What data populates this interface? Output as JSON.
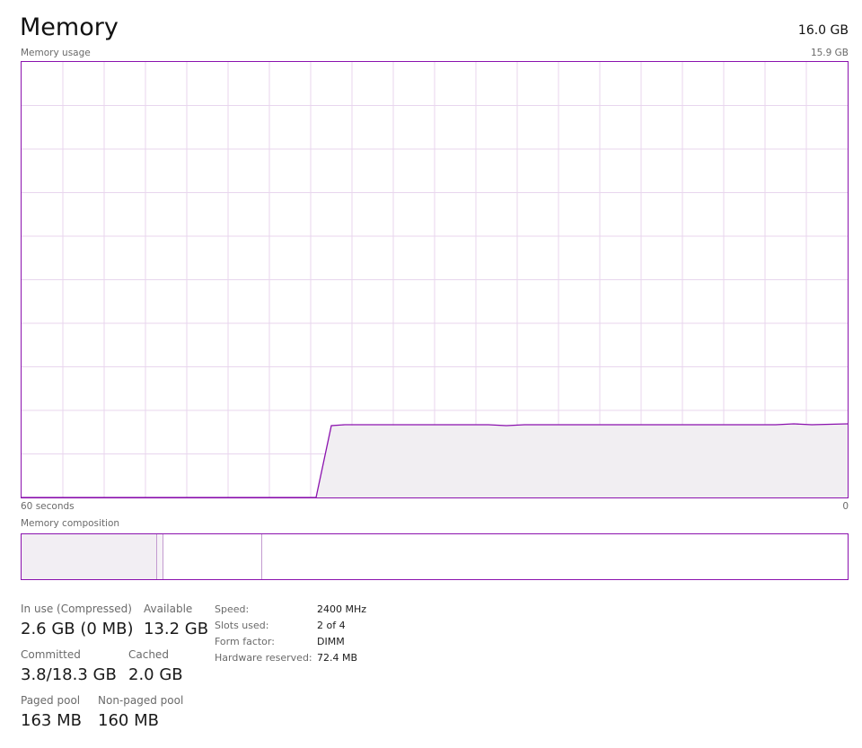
{
  "header": {
    "title": "Memory",
    "total": "16.0 GB"
  },
  "usage_graph": {
    "label": "Memory usage",
    "max_label": "15.9 GB",
    "left_axis_label": "60 seconds",
    "right_axis_label": "0"
  },
  "composition": {
    "label": "Memory composition"
  },
  "stats": {
    "in_use_label": "In use (Compressed)",
    "in_use_value": "2.6 GB (0 MB)",
    "available_label": "Available",
    "available_value": "13.2 GB",
    "committed_label": "Committed",
    "committed_value": "3.8/18.3 GB",
    "cached_label": "Cached",
    "cached_value": "2.0 GB",
    "paged_pool_label": "Paged pool",
    "paged_pool_value": "163 MB",
    "non_paged_pool_label": "Non-paged pool",
    "non_paged_pool_value": "160 MB"
  },
  "specs": {
    "speed_label": "Speed:",
    "speed_value": "2400 MHz",
    "slots_label": "Slots used:",
    "slots_value": "2 of 4",
    "form_factor_label": "Form factor:",
    "form_factor_value": "DIMM",
    "hw_reserved_label": "Hardware reserved:",
    "hw_reserved_value": "72.4 MB"
  },
  "colors": {
    "accent": "#8b12ae",
    "grid": "#e8d6ee",
    "fill": "#f1eef2"
  }
}
